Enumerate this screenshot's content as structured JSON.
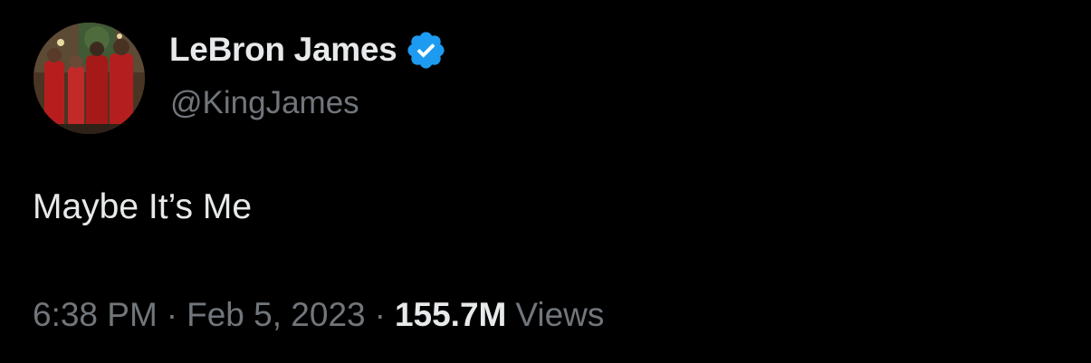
{
  "tweet": {
    "author": {
      "display_name": "LeBron James",
      "handle": "@KingJames",
      "verified_icon": "verified-badge-icon",
      "avatar_icon": "profile-photo-avatar"
    },
    "text": "Maybe It’s Me",
    "meta": {
      "time": "6:38 PM",
      "separator": "·",
      "date": "Feb 5, 2023",
      "views_count": "155.7M",
      "views_label": "Views"
    }
  },
  "colors": {
    "background": "#000000",
    "primary_text": "#e7e9ea",
    "secondary_text": "#71767b",
    "verified_blue": "#1d9bf0"
  }
}
